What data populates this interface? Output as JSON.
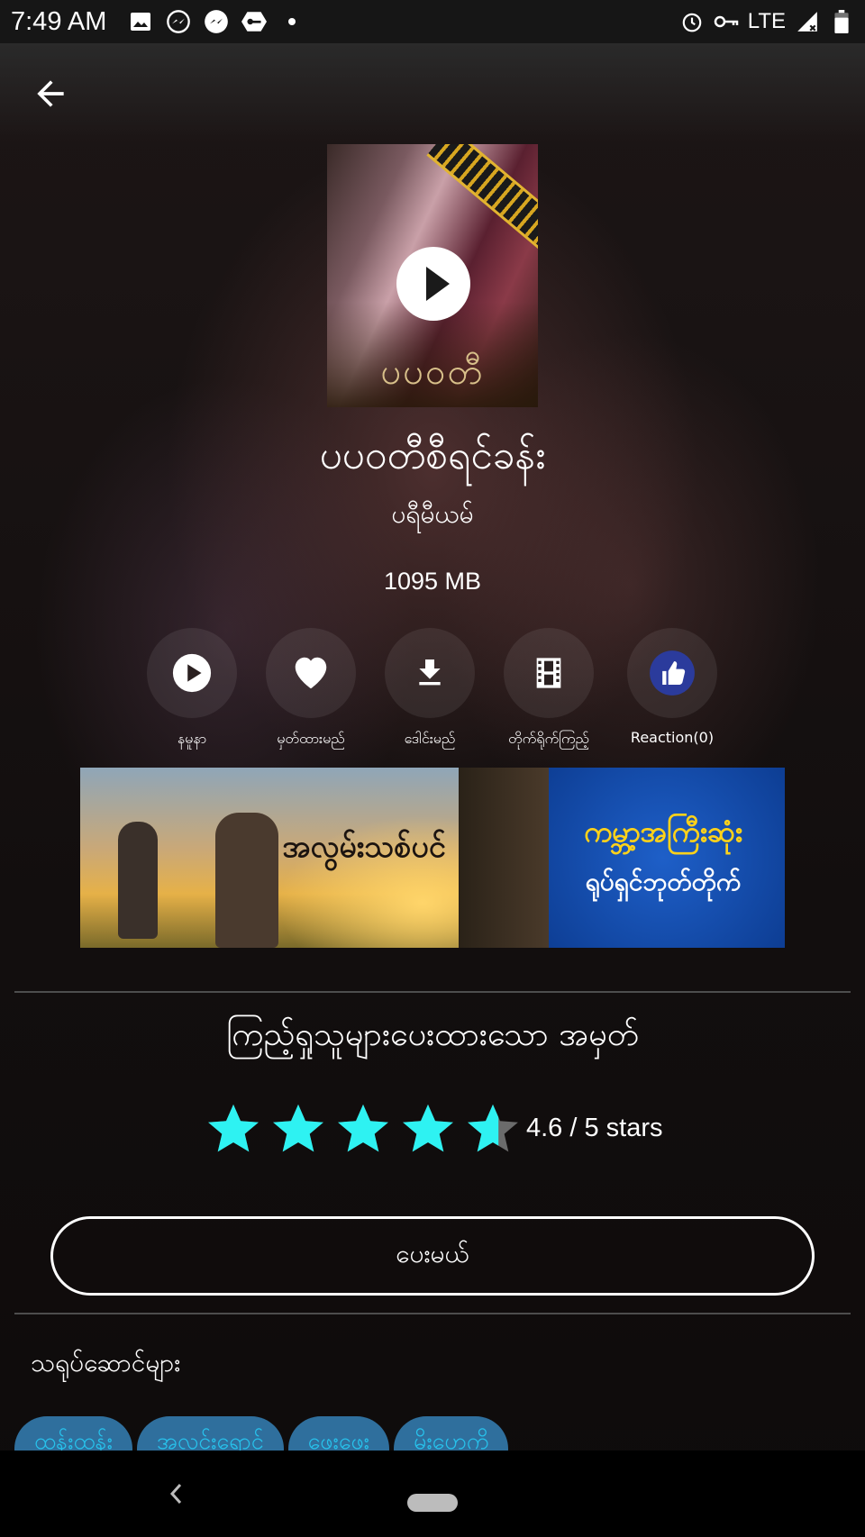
{
  "status_bar": {
    "time": "7:49 AM",
    "network": "LTE"
  },
  "movie": {
    "poster_title": "ပပဝတီ",
    "title": "ပပဝတီစီရင်ခန်း",
    "subtitle": "ပရီမီယမ်",
    "size": "1095 MB"
  },
  "actions": [
    {
      "label": "နမူနာ",
      "icon": "play-icon"
    },
    {
      "label": "မှတ်ထားမည်",
      "icon": "heart-icon"
    },
    {
      "label": "ဒေါင်းမည်",
      "icon": "download-icon"
    },
    {
      "label": "တိုက်ရိုက်ကြည့်",
      "icon": "film-icon"
    },
    {
      "label": "Reaction(0)",
      "icon": "thumbs-up-icon"
    }
  ],
  "banner": {
    "left_text": "အလွမ်းသစ်ပင်",
    "right_line1": "ကမ္ဘာ့အကြီးဆုံး",
    "right_line2": "ရုပ်ရှင်ဘုတ်တိုက်"
  },
  "rating": {
    "title": "ကြည့်ရှုသူများပေးထားသော အမှတ်",
    "value": 4.6,
    "max": 5,
    "text": "4.6 / 5 stars",
    "star_color": "#2ef2f2"
  },
  "give_rating_button": "ပေးမယ်",
  "cast": {
    "title": "သရုပ်ဆောင်များ",
    "members": [
      "ထန်းထန်း",
      "အလင်းရောင်",
      "ဖွေးဖွေး",
      "မိုးဟေကို"
    ]
  }
}
